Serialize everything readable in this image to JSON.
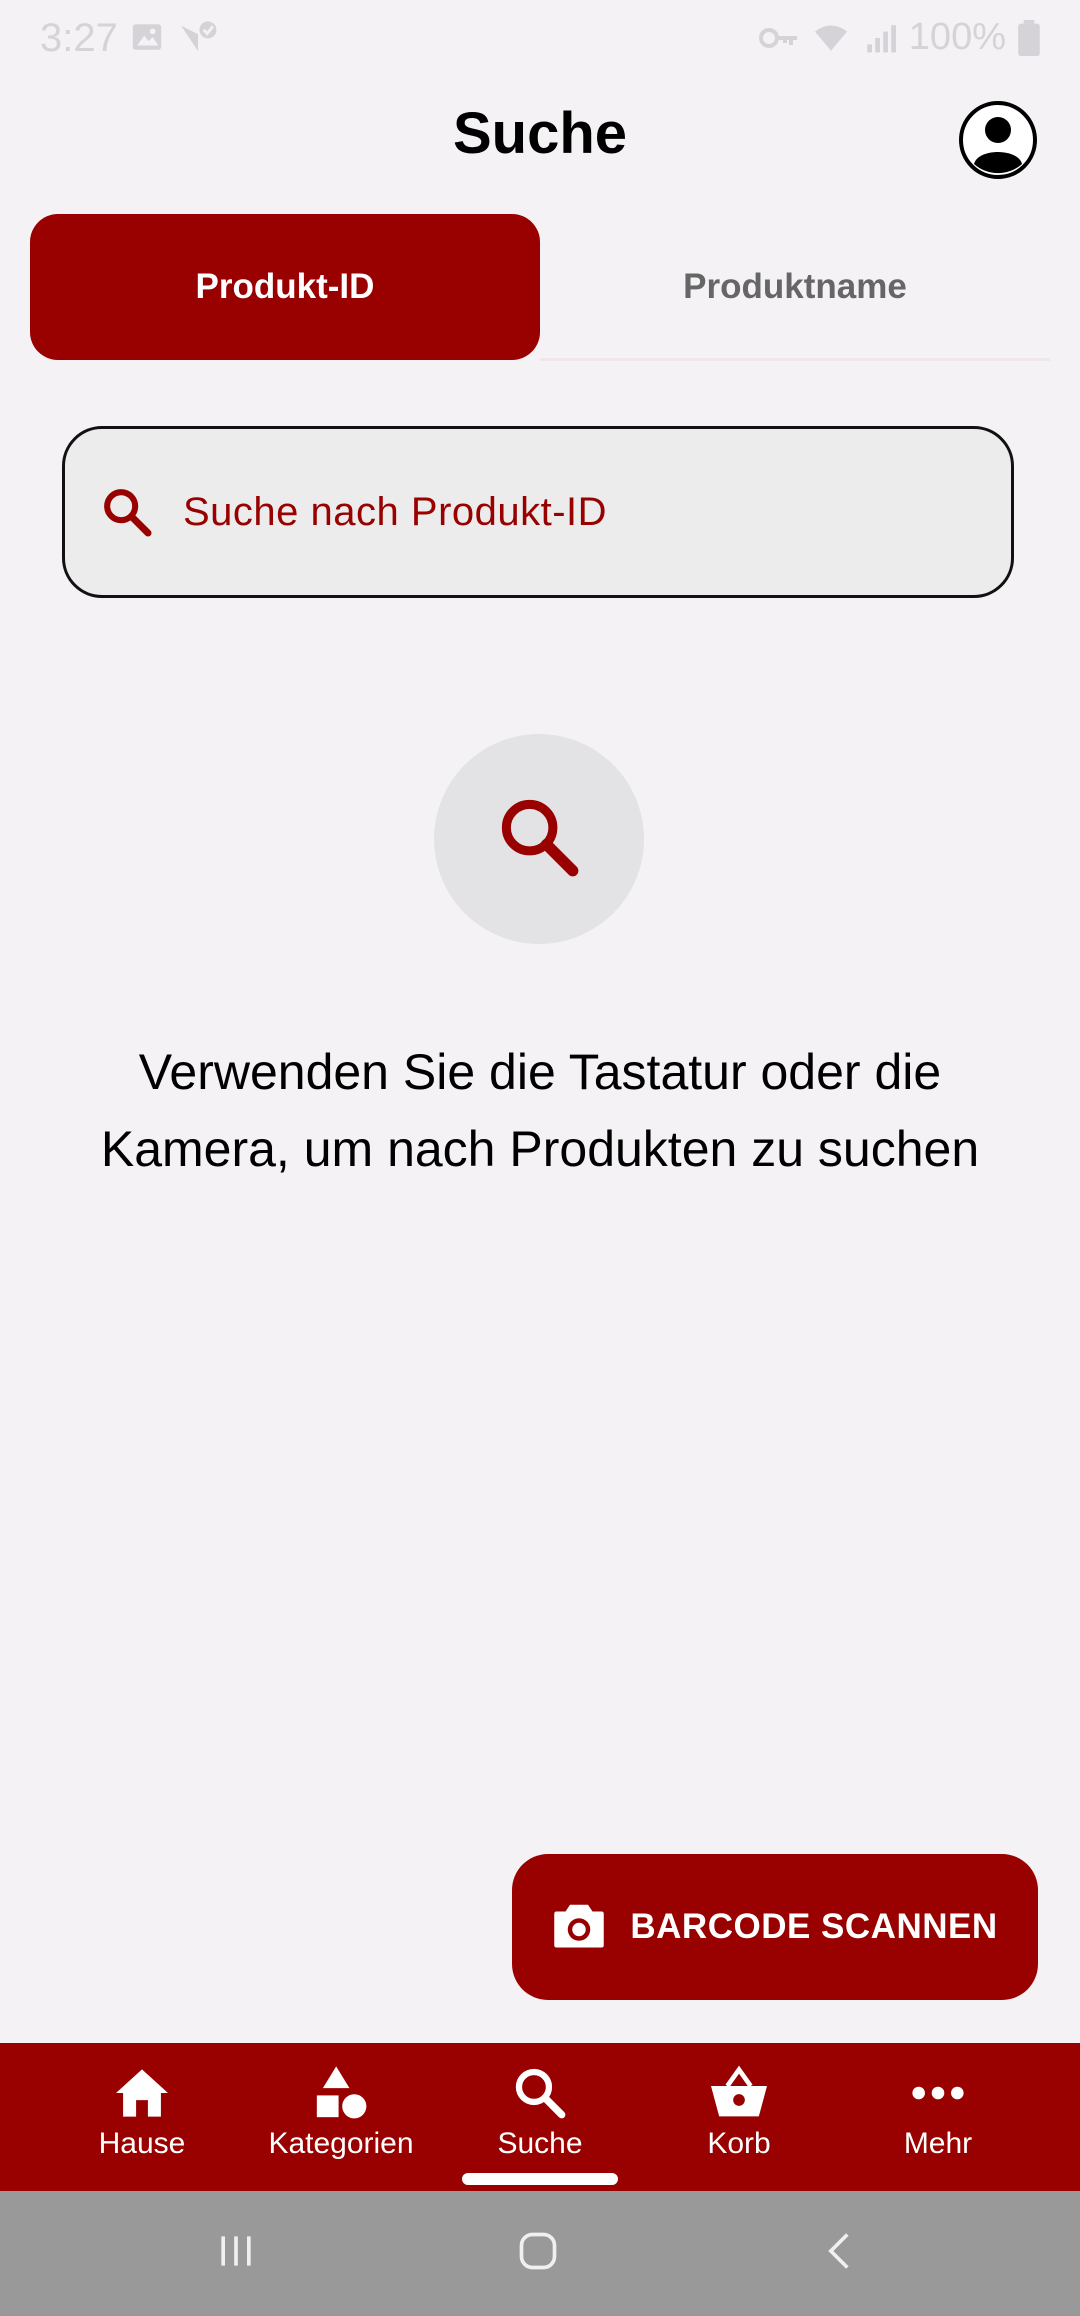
{
  "status_bar": {
    "time": "3:27",
    "battery": "100%",
    "icons": [
      "image-icon",
      "location-check-icon",
      "vpn-key-icon",
      "wifi-icon",
      "signal-icon",
      "battery-icon"
    ]
  },
  "header": {
    "title": "Suche",
    "profile_icon": "account-circle-icon"
  },
  "tabs": [
    {
      "label": "Produkt-ID",
      "active": true
    },
    {
      "label": "Produktname",
      "active": false
    }
  ],
  "search": {
    "placeholder": "Suche nach Produkt-ID",
    "icon": "search-icon"
  },
  "empty_state": {
    "icon": "search-icon",
    "message": "Verwenden Sie die Tastatur oder die Kamera, um nach Produkten zu suchen"
  },
  "scan_button": {
    "label": "BARCODE SCANNEN",
    "icon": "camera-icon"
  },
  "bottom_nav": {
    "items": [
      {
        "label": "Hause",
        "icon": "home-icon",
        "active": false
      },
      {
        "label": "Kategorien",
        "icon": "categories-icon",
        "active": false
      },
      {
        "label": "Suche",
        "icon": "search-icon",
        "active": true
      },
      {
        "label": "Korb",
        "icon": "basket-icon",
        "active": false
      },
      {
        "label": "Mehr",
        "icon": "more-icon",
        "active": false
      }
    ]
  },
  "system_nav": {
    "buttons": [
      "recents-icon",
      "home-circle-icon",
      "back-icon"
    ]
  },
  "colors": {
    "accent": "#990000",
    "background": "#f4f2f5",
    "field": "#ececec",
    "system_nav": "#999999"
  }
}
